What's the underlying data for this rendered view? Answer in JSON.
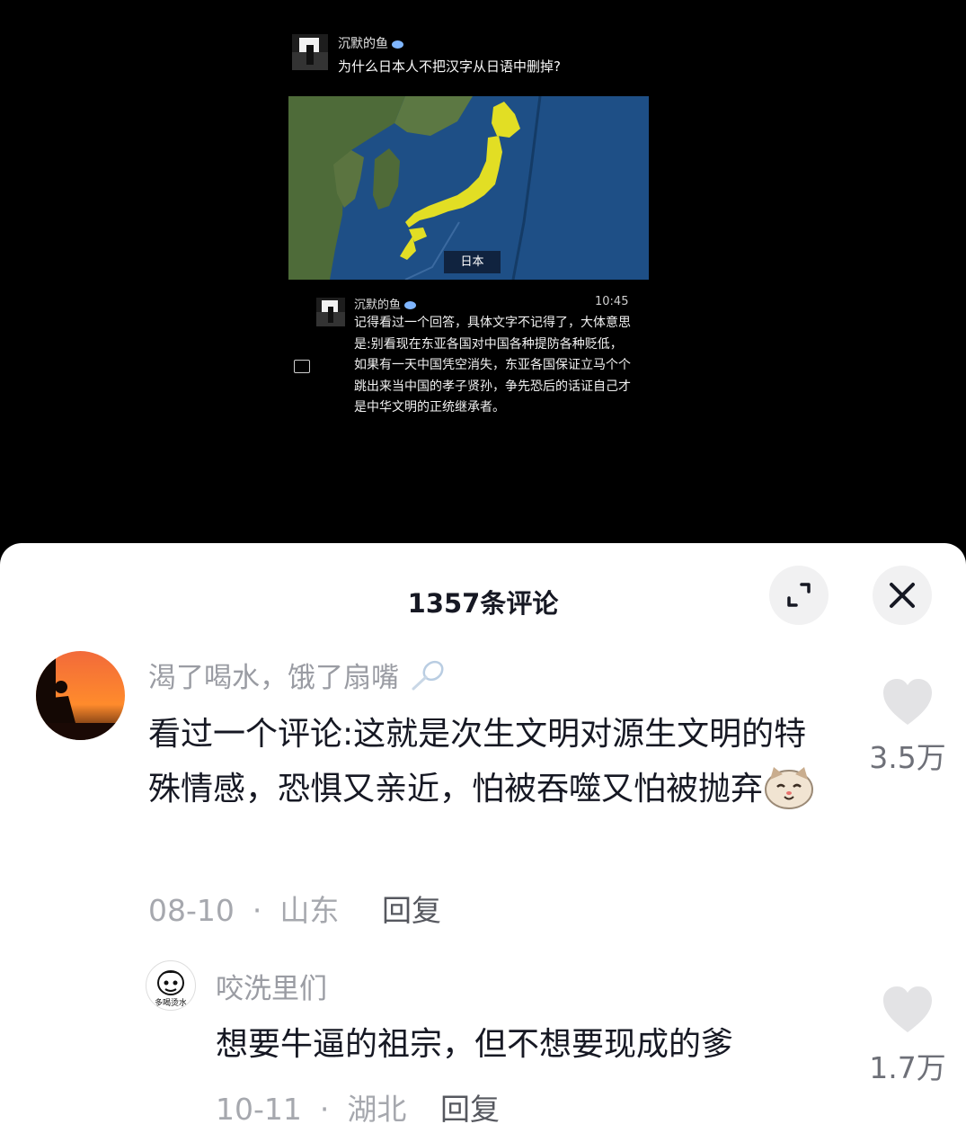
{
  "video": {
    "question": {
      "author": "沉默的鱼",
      "title": "为什么日本人不把汉字从日语中删掉?"
    },
    "map": {
      "label": "日本"
    },
    "reply": {
      "author": "沉默的鱼",
      "time": "10:45",
      "text": "记得看过一个回答，具体文字不记得了，大体意思是:别看现在东亚各国对中国各种提防各种贬低，如果有一天中国凭空消失，东亚各国保证立马个个跳出来当中国的孝子贤孙，争先恐后的话证自己才是中华文明的正统继承者。"
    }
  },
  "comments_sheet": {
    "count_label": "1357条评论",
    "comments": [
      {
        "author": "渴了喝水，饿了扇嘴",
        "text": "看过一个评论:这就是次生文明对源生文明的特殊情感，恐惧又亲近，怕被吞噬又怕被抛弃",
        "date": "08-10",
        "location": "山东",
        "reply_label": "回复",
        "likes": "3.5万"
      },
      {
        "author": "咬洗里们",
        "text": "想要牛逼的祖宗，但不想要现成的爹",
        "date": "10-11",
        "location": "湖北",
        "reply_label": "回复",
        "likes": "1.7万"
      }
    ]
  },
  "colors": {
    "map_highlight": "#e2de24",
    "text_primary": "#161823",
    "text_secondary": "#9a9ca3",
    "like_icon": "#e3e3e5"
  },
  "icons": {
    "expand": "expand-icon",
    "close": "close-icon",
    "like": "heart-icon",
    "comment": "chat-bubble-icon",
    "verified": "eye-icon"
  }
}
